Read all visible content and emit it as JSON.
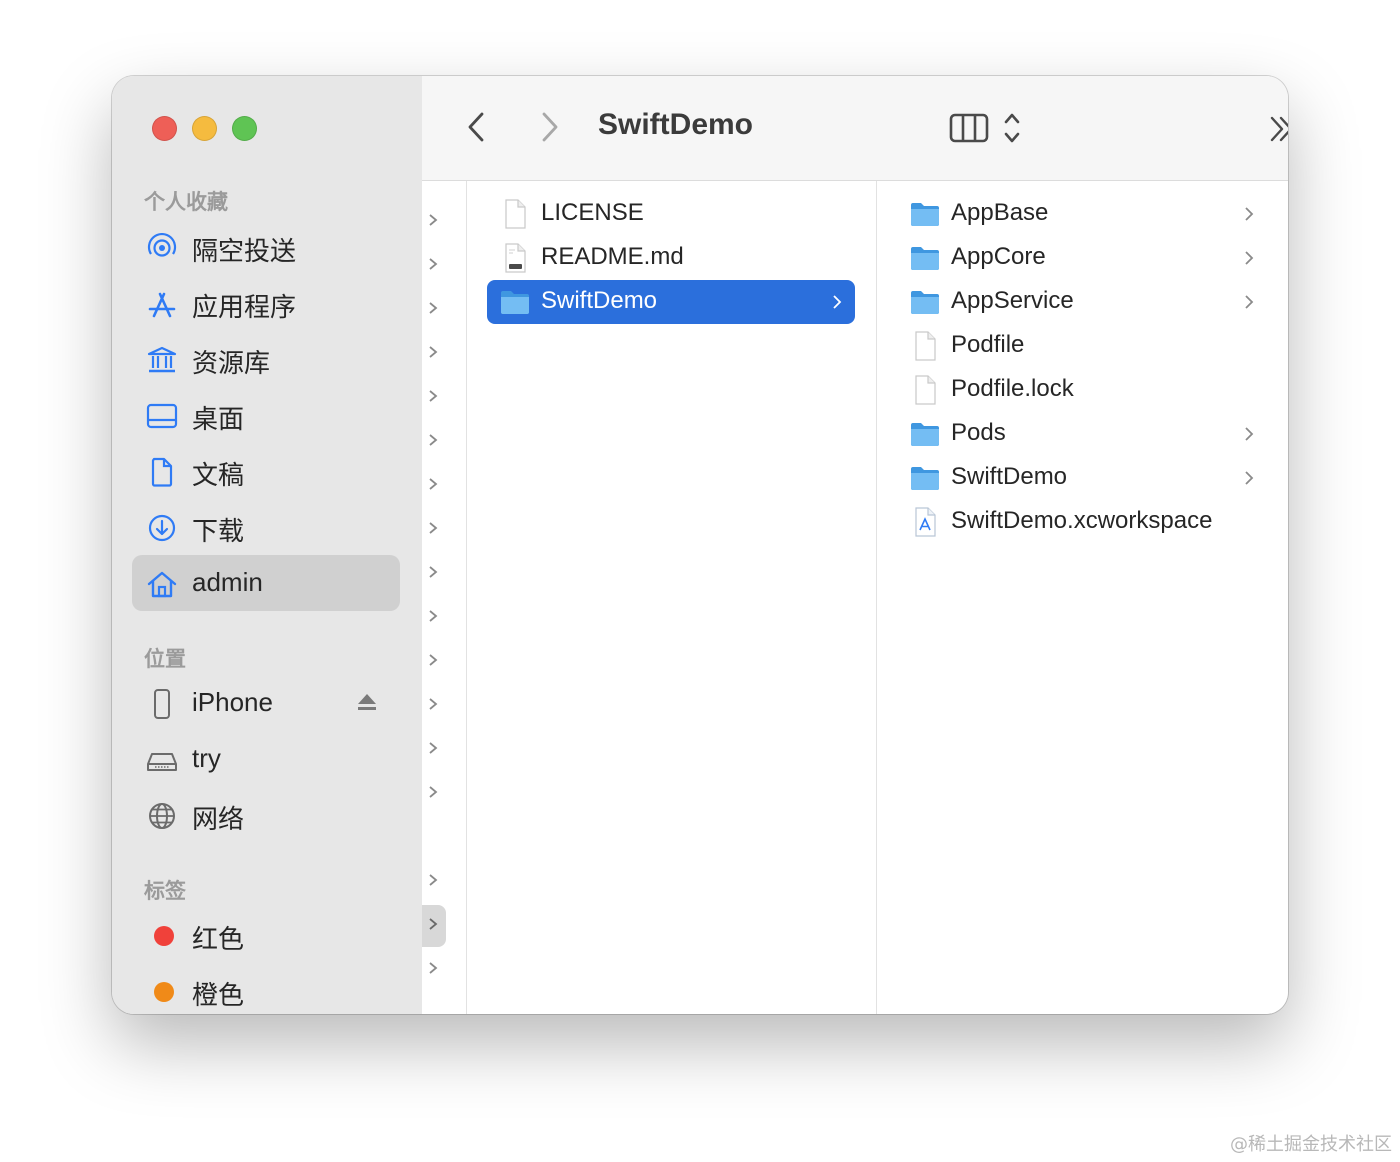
{
  "window": {
    "title": "SwiftDemo"
  },
  "sidebar": {
    "favorites_title": "个人收藏",
    "favorites": [
      {
        "label": "隔空投送",
        "icon": "airdrop-icon"
      },
      {
        "label": "应用程序",
        "icon": "applications-icon"
      },
      {
        "label": "资源库",
        "icon": "library-icon"
      },
      {
        "label": "桌面",
        "icon": "desktop-icon"
      },
      {
        "label": "文稿",
        "icon": "document-icon"
      },
      {
        "label": "下载",
        "icon": "download-icon"
      },
      {
        "label": "admin",
        "icon": "home-icon",
        "selected": true
      }
    ],
    "locations_title": "位置",
    "locations": [
      {
        "label": "iPhone",
        "icon": "iphone-icon",
        "eject": true
      },
      {
        "label": "try",
        "icon": "drive-icon"
      },
      {
        "label": "网络",
        "icon": "network-icon"
      }
    ],
    "tags_title": "标签",
    "tags": [
      {
        "label": "红色",
        "color": "#f0413a"
      },
      {
        "label": "橙色",
        "color": "#f08a18"
      }
    ]
  },
  "column1": {
    "items": [
      {
        "label": "LICENSE",
        "icon": "file-icon"
      },
      {
        "label": "README.md",
        "icon": "markdown-file-icon"
      },
      {
        "label": "SwiftDemo",
        "icon": "folder-icon",
        "selected": true,
        "has_children": true
      }
    ]
  },
  "column2": {
    "items": [
      {
        "label": "AppBase",
        "icon": "folder-icon",
        "has_children": true
      },
      {
        "label": "AppCore",
        "icon": "folder-icon",
        "has_children": true
      },
      {
        "label": "AppService",
        "icon": "folder-icon",
        "has_children": true
      },
      {
        "label": "Podfile",
        "icon": "file-icon"
      },
      {
        "label": "Podfile.lock",
        "icon": "file-icon"
      },
      {
        "label": "Pods",
        "icon": "folder-icon",
        "has_children": true
      },
      {
        "label": "SwiftDemo",
        "icon": "folder-icon",
        "has_children": true
      },
      {
        "label": "SwiftDemo.xcworkspace",
        "icon": "xcworkspace-icon"
      }
    ]
  },
  "watermark": "@稀土掘金技术社区",
  "colors": {
    "accent": "#2b6fdc",
    "sidebar_icon": "#2f7bf5",
    "folder": "#5fb1ee"
  }
}
